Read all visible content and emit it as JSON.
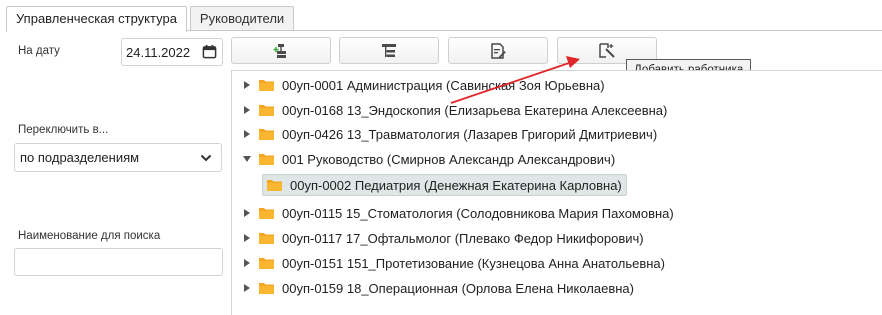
{
  "tabs": [
    {
      "label": "Управленческая структура",
      "active": true
    },
    {
      "label": "Руководители",
      "active": false
    }
  ],
  "filters": {
    "date_label": "На дату",
    "date_value": "24.11.2022",
    "switch_label": "Переключить в...",
    "switch_value": "по подразделениям",
    "search_label": "Наименование для поиска",
    "search_value": ""
  },
  "toolbar": {
    "tooltip": "Добавить работника"
  },
  "tree": [
    {
      "label": "00уп-0001 Администрация (Савинская Зоя Юрьевна)",
      "expanded": false,
      "level": 0
    },
    {
      "label": "00уп-0168 13_Эндоскопия (Елизарьева Екатерина Алексеевна)",
      "expanded": false,
      "level": 0
    },
    {
      "label": "00уп-0426 13_Травматология (Лазарев Григорий Дмитриевич)",
      "expanded": false,
      "level": 0
    },
    {
      "label": "001 Руководство (Смирнов Александр Александрович)",
      "expanded": true,
      "level": 0
    },
    {
      "label": "00уп-0002 Педиатрия (Денежная Екатерина Карловна)",
      "expanded": false,
      "level": 1,
      "selected": true
    },
    {
      "label": "00уп-0115 15_Стоматология (Солодовникова Мария Пахомовна)",
      "expanded": false,
      "level": 0
    },
    {
      "label": "00уп-0117 17_Офтальмолог (Плевако Федор Никифорович)",
      "expanded": false,
      "level": 0
    },
    {
      "label": "00уп-0151 151_Протетизование (Кузнецова Анна Анатольевна)",
      "expanded": false,
      "level": 0
    },
    {
      "label": "00уп-0159 18_Операционная (Орлова Елена Николаевна)",
      "expanded": false,
      "level": 0
    }
  ],
  "colors": {
    "folder": "#f5a623",
    "accent_arrow": "#e0262a",
    "selected_row": "#dfe6e6"
  }
}
